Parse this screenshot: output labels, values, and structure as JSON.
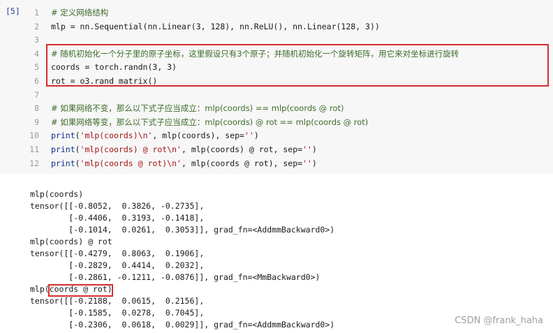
{
  "cell": {
    "prompt": "[5]",
    "lines": [
      {
        "n": "1",
        "parts": [
          [
            "cm",
            "# 定义网络结构"
          ]
        ]
      },
      {
        "n": "2",
        "parts": [
          [
            "plain",
            "mlp = nn.Sequential(nn.Linear(3, 128), nn.ReLU(), nn.Linear(128, 3))"
          ]
        ]
      },
      {
        "n": "3",
        "parts": [
          [
            "plain",
            ""
          ]
        ]
      },
      {
        "n": "4",
        "parts": [
          [
            "cm",
            "# 随机初始化一个分子里的原子坐标，这里假设只有3个原子；并随机初始化一个旋转矩阵，用它来对坐标进行旋转"
          ]
        ]
      },
      {
        "n": "5",
        "parts": [
          [
            "plain",
            "coords = torch.randn(3, 3)"
          ]
        ]
      },
      {
        "n": "6",
        "parts": [
          [
            "plain",
            "rot = o3.rand_matrix()"
          ]
        ]
      },
      {
        "n": "7",
        "parts": [
          [
            "plain",
            ""
          ]
        ]
      },
      {
        "n": "8",
        "parts": [
          [
            "cm",
            "# 如果网络不变，那么以下式子应当成立：mlp(coords) == mlp(coords @ rot)"
          ]
        ]
      },
      {
        "n": "9",
        "parts": [
          [
            "cm",
            "# 如果网络等变，那么以下式子应当成立：mlp(coords) @ rot == mlp(coords @ rot)"
          ]
        ]
      },
      {
        "n": "10",
        "parts": [
          [
            "kw",
            "print"
          ],
          [
            "plain",
            "("
          ],
          [
            "str",
            "'mlp(coords)\\n'"
          ],
          [
            "plain",
            ", mlp(coords), sep="
          ],
          [
            "str",
            "''"
          ],
          [
            "plain",
            ")"
          ]
        ]
      },
      {
        "n": "11",
        "parts": [
          [
            "kw",
            "print"
          ],
          [
            "plain",
            "("
          ],
          [
            "str",
            "'mlp(coords) @ rot\\n'"
          ],
          [
            "plain",
            ", mlp(coords) @ rot, sep="
          ],
          [
            "str",
            "''"
          ],
          [
            "plain",
            ")"
          ]
        ]
      },
      {
        "n": "12",
        "parts": [
          [
            "kw",
            "print"
          ],
          [
            "plain",
            "("
          ],
          [
            "str",
            "'mlp(coords @ rot)\\n'"
          ],
          [
            "plain",
            ", mlp(coords @ rot), sep="
          ],
          [
            "str",
            "''"
          ],
          [
            "plain",
            ")"
          ]
        ]
      }
    ]
  },
  "output": {
    "lines": [
      "mlp(coords)",
      "tensor([[-0.8052,  0.3826, -0.2735],",
      "        [-0.4406,  0.3193, -0.1418],",
      "        [-0.1014,  0.0261,  0.3053]], grad_fn=<AddmmBackward0>)",
      "mlp(coords) @ rot",
      "tensor([[-0.4279,  0.8063,  0.1906],",
      "        [-0.2829,  0.4414,  0.2032],",
      "        [-0.2861, -0.1211, -0.0876]], grad_fn=<MmBackward0>)",
      "mlp(coords @ rot)",
      "tensor([[-0.2188,  0.0615,  0.2156],",
      "        [-0.1585,  0.0278,  0.7045],",
      "        [-0.2306,  0.0618,  0.0029]], grad_fn=<AddmmBackward0>)"
    ]
  },
  "watermark": "CSDN @frank_haha",
  "colors": {
    "highlight_border": "#d32f2f",
    "cell_background": "#f7f7f7",
    "comment": "#3d6b2a",
    "string": "#a31515"
  }
}
